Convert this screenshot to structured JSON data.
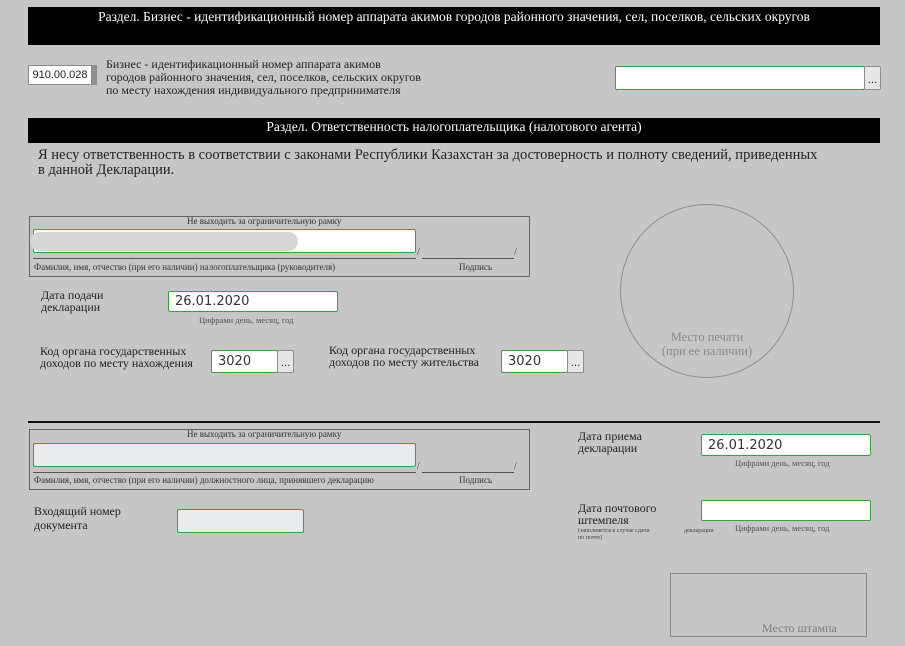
{
  "section_biz": {
    "title": "Раздел. Бизнес - идентификационный номер аппарата акимов городов районного значения, сел, поселков, сельских округов",
    "code": "910.00.028",
    "desc_line1": "Бизнес - идентификационный номер аппарата акимов",
    "desc_line2": "городов районного значения, сел, поселков, сельских округов",
    "desc_line3": "по месту нахождения индивидуального предпринимателя",
    "bin_value": "",
    "dots": "..."
  },
  "section_resp": {
    "title": "Раздел. Ответственность налогоплательщика (налогового агента)",
    "text_line1": "Я несу ответственность в соответствии с законами Республики Казахстан за достоверность и полноту сведений, приведенных",
    "text_line2": "в данной Декларации."
  },
  "taxpayer_block": {
    "frame_note": "Не выходить за ограничительную рамку",
    "name_value": "",
    "slash": "/",
    "name_caption": "Фамилия, имя, отчество (при его наличии) налогоплательщика (руководителя)",
    "signature_caption": "Подпись"
  },
  "submit_date": {
    "label_line1": "Дата подачи",
    "label_line2": "декларации",
    "value": "26.01.2020",
    "hint": "Цифрами день, месяц, год"
  },
  "org_location": {
    "label_line1": "Код органа государственных",
    "label_line2": "доходов по месту нахождения",
    "value": "3020",
    "dots": "..."
  },
  "org_residence": {
    "label_line1": "Код органа государственных",
    "label_line2": "доходов по месту жительства",
    "value": "3020",
    "dots": "..."
  },
  "seal": {
    "line1": "Место печати",
    "line2": "(при ее наличии)"
  },
  "official_block": {
    "frame_note": "Не выходить за ограничительную рамку",
    "name_value": "",
    "slash": "/",
    "name_caption": "Фамилия, имя, отчество (при его наличии) должностного лица, принявшего декларацию",
    "signature_caption": "Подпись"
  },
  "receipt_date": {
    "label_line1": "Дата приема",
    "label_line2": "декларации",
    "value": "26.01.2020",
    "hint": "Цифрами день, месяц, год"
  },
  "incoming_number": {
    "label_line1": "Входящий номер",
    "label_line2": "документа",
    "value": ""
  },
  "postmark_date": {
    "label_line1": "Дата почтового",
    "label_line2": "штемпеля",
    "note_line1": "(заполняется в случае сдачи",
    "note_line2": "по почте)",
    "note_word": "декларации",
    "value": "",
    "hint": "Цифрами день, месяц, год"
  },
  "stamp": {
    "label": "Место штампа"
  }
}
